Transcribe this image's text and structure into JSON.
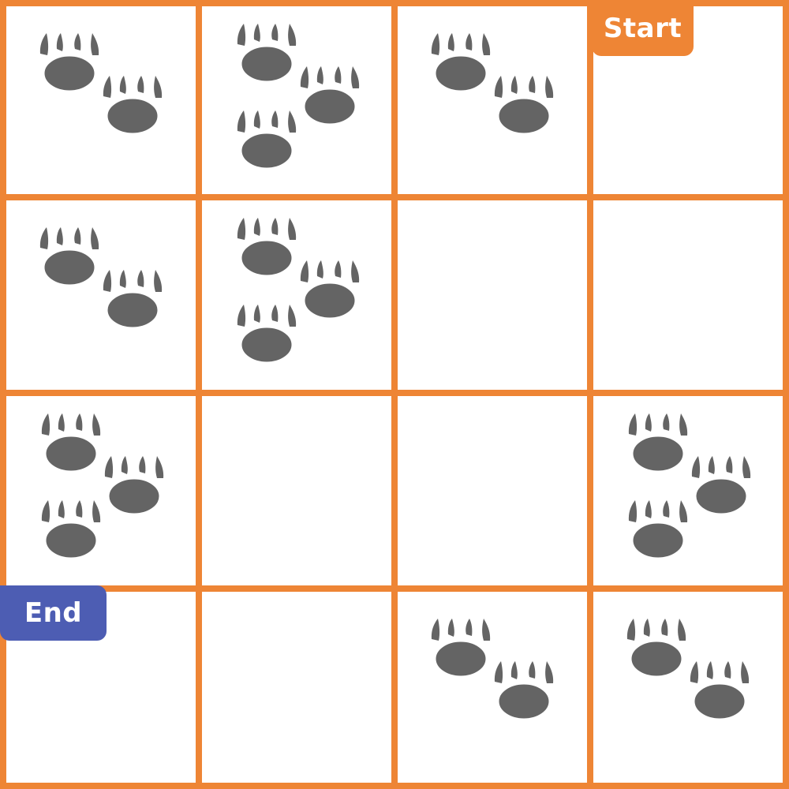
{
  "board": {
    "rows": 4,
    "cols": 4,
    "grid_color": "#EE8535",
    "paw_color": "#646464",
    "start": {
      "label": "Start",
      "row": 0,
      "col": 3,
      "color": "#EE8535"
    },
    "end": {
      "label": "End",
      "row": 3,
      "col": 0,
      "color": "#4D5DB3"
    },
    "cells": [
      [
        2,
        3,
        2,
        0
      ],
      [
        2,
        3,
        0,
        0
      ],
      [
        3,
        0,
        0,
        3
      ],
      [
        0,
        0,
        2,
        2
      ]
    ]
  },
  "icons": {
    "paw": "paw-print-icon"
  }
}
